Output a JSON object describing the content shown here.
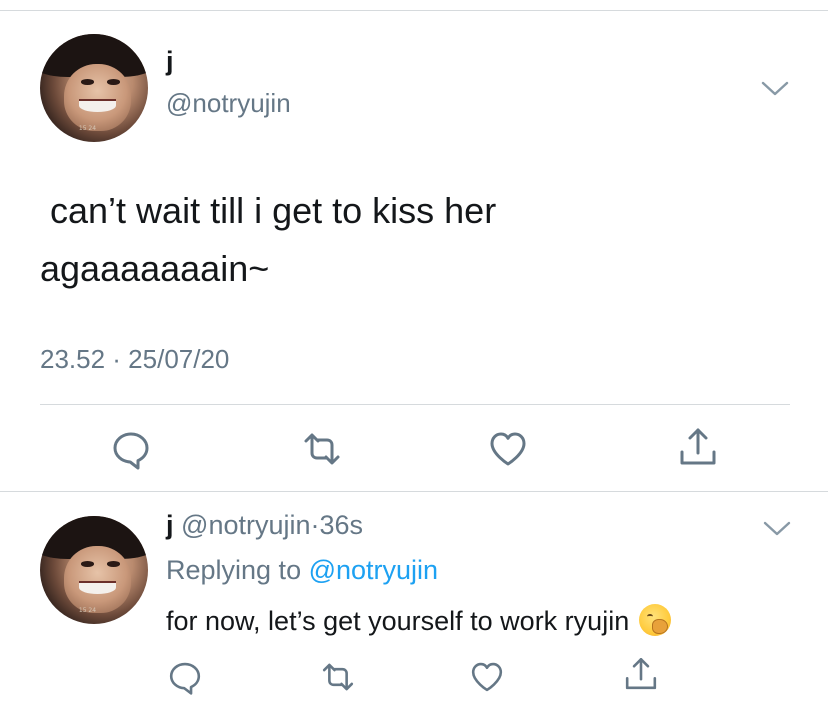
{
  "main_tweet": {
    "name": "j",
    "handle": "@notryujin",
    "text": " can’t wait till i get to kiss her\nagaaaaaaain~",
    "timestamp": "23.52 · 25/07/20"
  },
  "reply": {
    "name": "j",
    "handle": "@notryujin",
    "dot": "·",
    "time": "36s",
    "replying_prefix": "Replying to ",
    "replying_mention": "@notryujin",
    "text": "for now, let’s get yourself to work ryujin"
  },
  "colors": {
    "text": "#14171a",
    "secondary": "#657786",
    "link": "#1da1f2",
    "divider": "#d6dadd"
  },
  "icons": [
    "chevron-down-icon",
    "reply-icon",
    "retweet-icon",
    "like-icon",
    "share-icon",
    "yawning-face-emoji"
  ]
}
